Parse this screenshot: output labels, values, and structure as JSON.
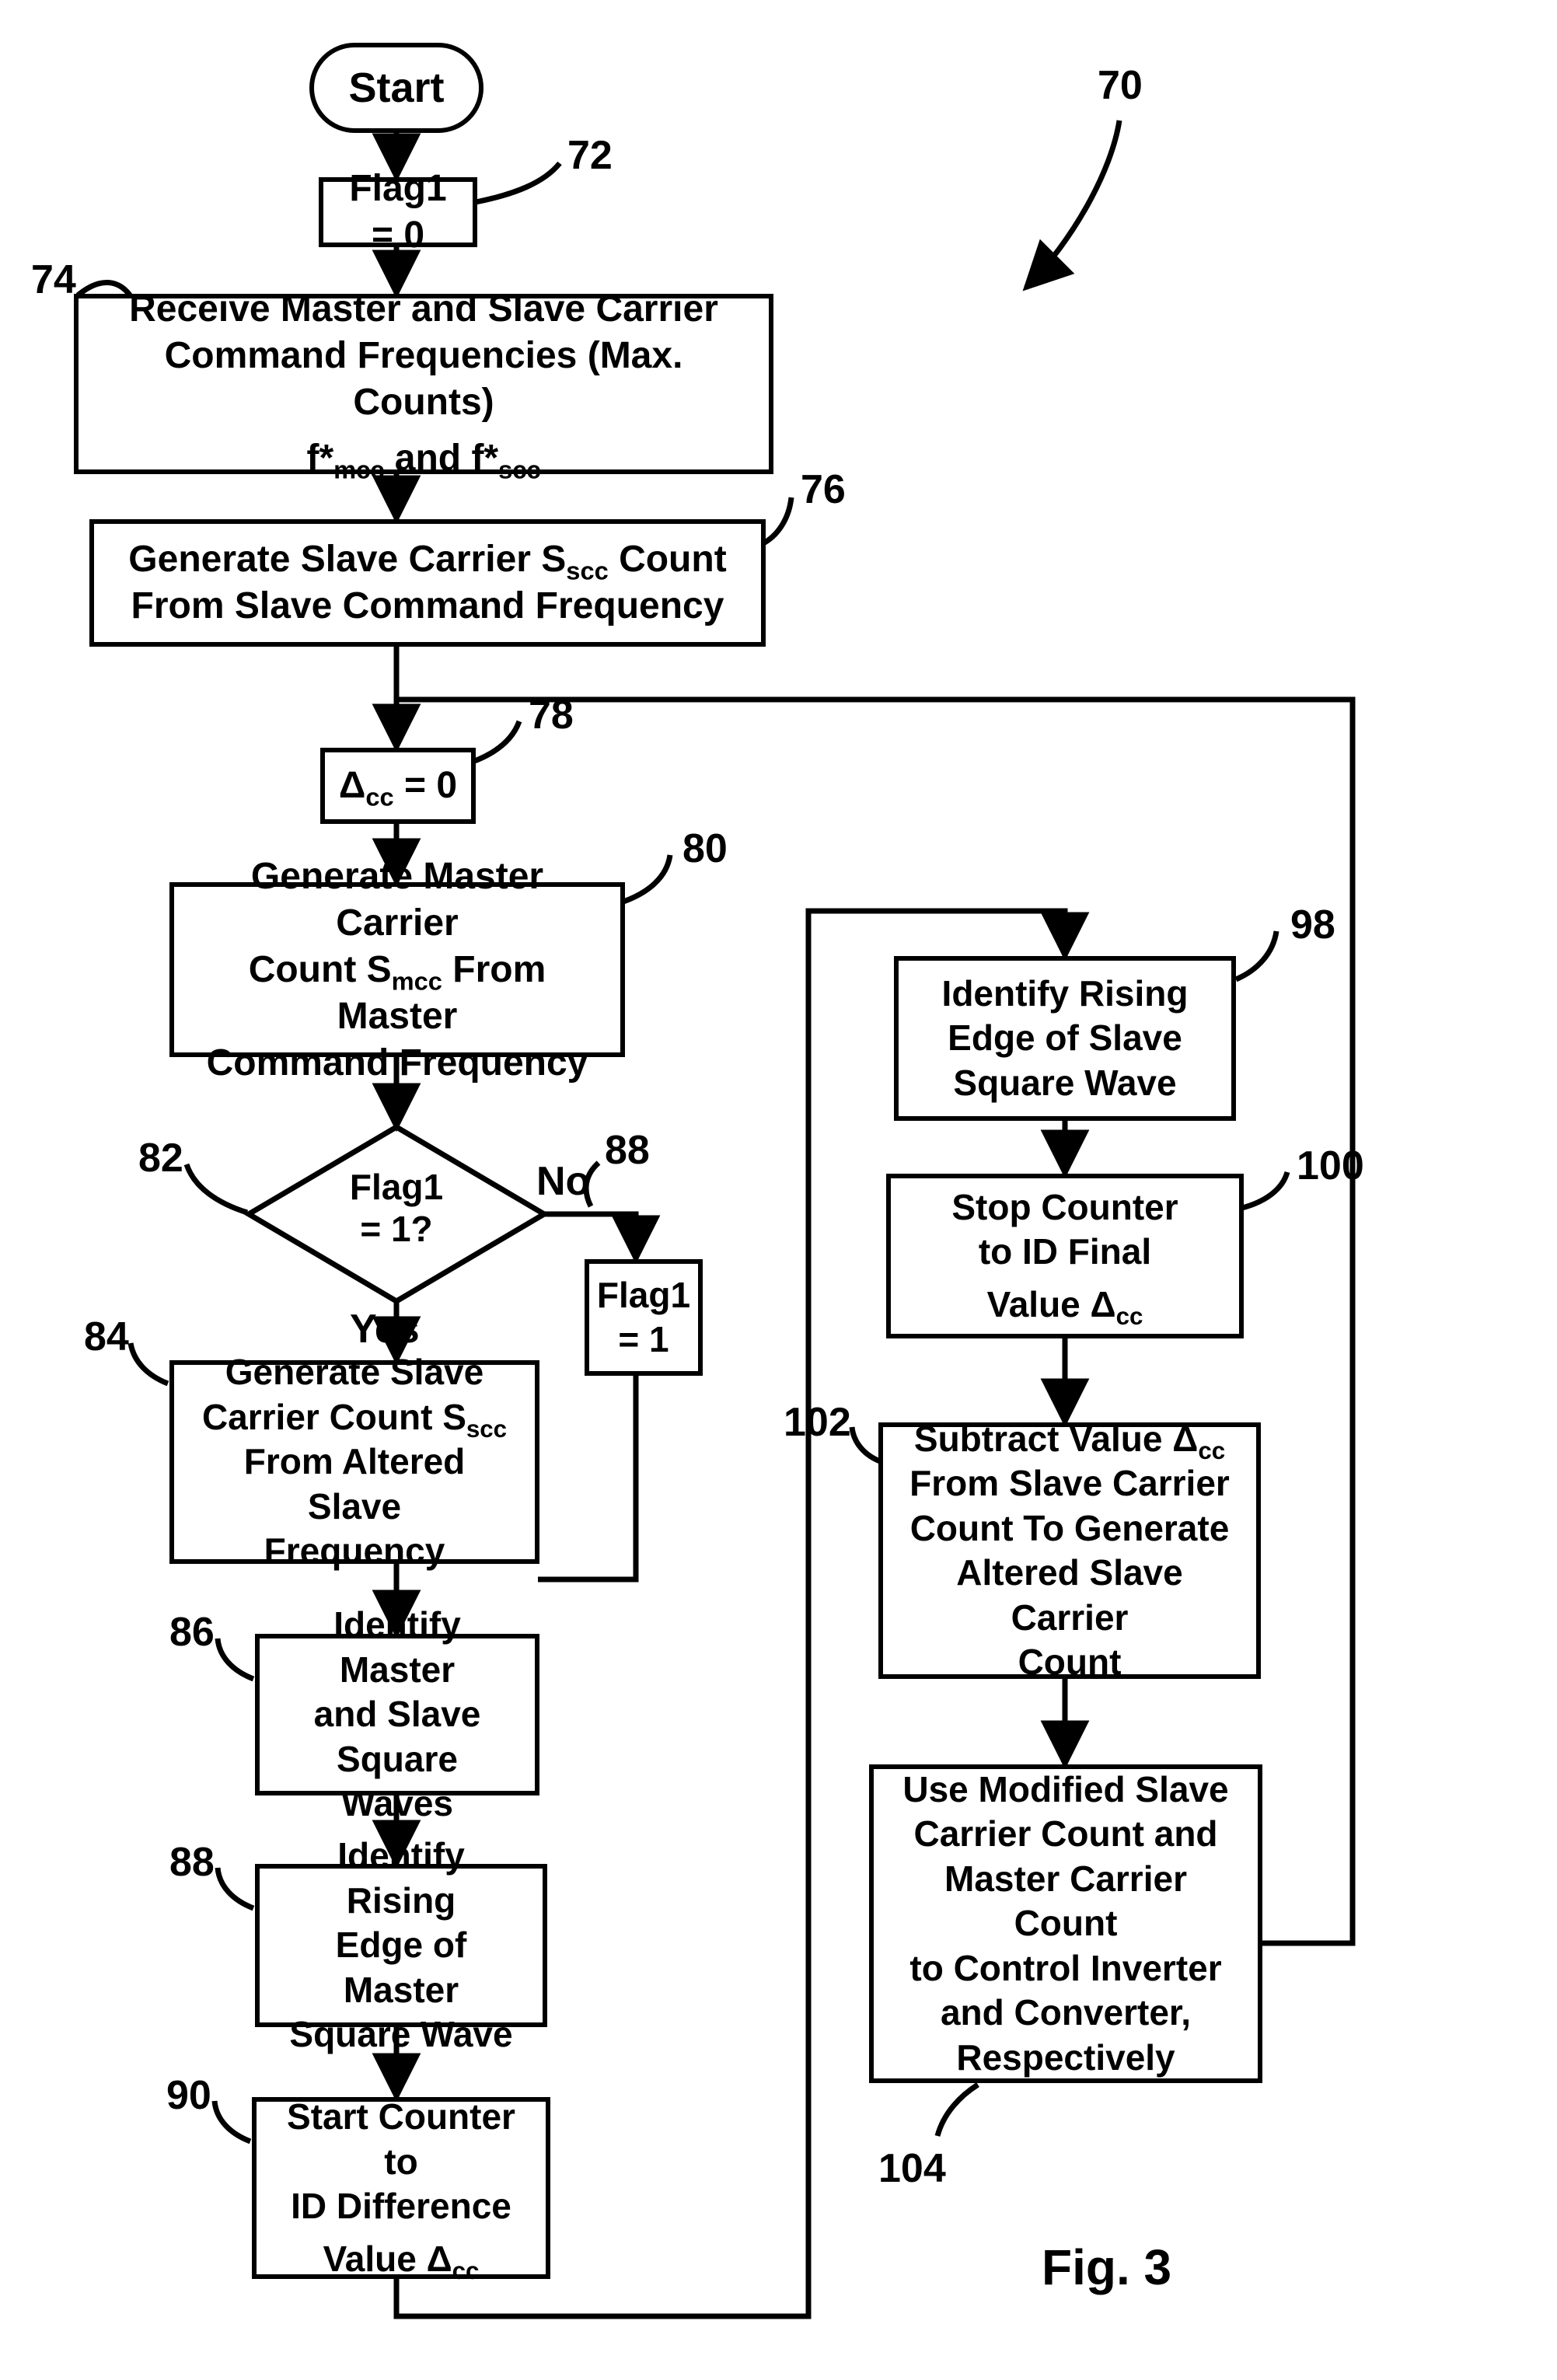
{
  "terminator": {
    "start": "Start"
  },
  "labels": {
    "n70": "70",
    "n72": "72",
    "n74": "74",
    "n76": "76",
    "n78": "78",
    "n80": "80",
    "n82": "82",
    "n84": "84",
    "n86": "86",
    "n88a": "88",
    "n88b": "88",
    "n90": "90",
    "n98": "98",
    "n100": "100",
    "n102": "102",
    "n104": "104",
    "yes": "Yes",
    "no": "No",
    "fig": "Fig. 3"
  },
  "boxes": {
    "b72": "Flag1 = 0",
    "b74_l1": "Receive Master and Slave Carrier",
    "b74_l2": "Command Frequencies (Max. Counts)",
    "b74_l3": "f*ₘcc and f*ₛcc",
    "b76_l1": "Generate Slave Carrier Sₛcc Count",
    "b76_l2": "From Slave Command Frequency",
    "b78": "Δcc = 0",
    "b80_l1": "Generate Master Carrier",
    "b80_l2": "Count Sₘcc From Master",
    "b80_l3": "Command Frequency",
    "b82_l1": "Flag1",
    "b82_l2": "= 1?",
    "b84_l1": "Generate Slave",
    "b84_l2": "Carrier Count Sₛcc",
    "b84_l3": "From Altered Slave",
    "b84_l4": "Frequency",
    "b88f_l1": "Flag1",
    "b88f_l2": "= 1",
    "b86_l1": "Identify Master",
    "b86_l2": "and Slave",
    "b86_l3": "Square Waves",
    "b88r_l1": "Identify Rising",
    "b88r_l2": "Edge of Master",
    "b88r_l3": "Square Wave",
    "b90_l1": "Start Counter to",
    "b90_l2": "ID Difference",
    "b90_l3": "Value Δcc",
    "b98_l1": "Identify Rising",
    "b98_l2": "Edge of Slave",
    "b98_l3": "Square Wave",
    "b100_l1": "Stop Counter",
    "b100_l2": "to ID Final",
    "b100_l3": "Value Δcc",
    "b102_l1": "Subtract Value Δcc",
    "b102_l2": "From Slave Carrier",
    "b102_l3": "Count To Generate",
    "b102_l4": "Altered Slave Carrier",
    "b102_l5": "Count",
    "b104_l1": "Use Modified Slave",
    "b104_l2": "Carrier Count and",
    "b104_l3": "Master Carrier Count",
    "b104_l4": "to Control Inverter",
    "b104_l5": "and Converter,",
    "b104_l6": "Respectively"
  }
}
